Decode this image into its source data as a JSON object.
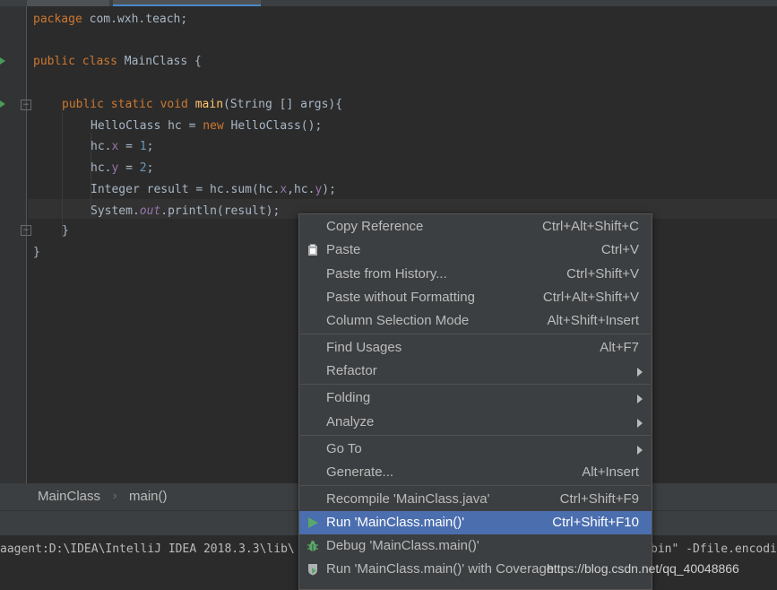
{
  "tabs": [
    "",
    ""
  ],
  "code": {
    "line1": {
      "kw": "package",
      "rest": " com.wxh.teach;"
    },
    "line3": {
      "kw": "public class",
      "rest": " MainClass {"
    },
    "line5": {
      "kw": "public static void",
      "fn": "main",
      "rest": "(String [] args){"
    },
    "line6": {
      "a": "HelloClass hc = ",
      "kw": "new",
      "b": " HelloClass();"
    },
    "line7": {
      "a": "hc.",
      "f": "x",
      "b": " = ",
      "n": "1",
      "c": ";"
    },
    "line8": {
      "a": "hc.",
      "f": "y",
      "b": " = ",
      "n": "2",
      "c": ";"
    },
    "line9": {
      "a": "Integer result = hc.sum(hc.",
      "f1": "x",
      "b": ",hc.",
      "f2": "y",
      "c": ");"
    },
    "line10": {
      "a": "System.",
      "sf": "out",
      "b": ".println(result);"
    },
    "line11": "}",
    "line12": "}"
  },
  "breadcrumb": {
    "class_name": "MainClass",
    "separator": "›",
    "method": "main()"
  },
  "console": {
    "left": "aagent:D:\\IDEA\\IntelliJ IDEA 2018.3.3\\lib\\",
    "right": "bin\" -Dfile.encodi"
  },
  "menu": {
    "items": [
      {
        "label": "Copy Reference",
        "shortcut": "Ctrl+Alt+Shift+C"
      },
      {
        "label": "Paste",
        "shortcut": "Ctrl+V",
        "icon": "clipboard-icon"
      },
      {
        "label": "Paste from History...",
        "shortcut": "Ctrl+Shift+V"
      },
      {
        "label": "Paste without Formatting",
        "shortcut": "Ctrl+Alt+Shift+V"
      },
      {
        "label": "Column Selection Mode",
        "shortcut": "Alt+Shift+Insert"
      },
      {
        "label": "Find Usages",
        "shortcut": "Alt+F7"
      },
      {
        "label": "Refactor",
        "submenu": true
      },
      {
        "label": "Folding",
        "submenu": true
      },
      {
        "label": "Analyze",
        "submenu": true
      },
      {
        "label": "Go To",
        "submenu": true
      },
      {
        "label": "Generate...",
        "shortcut": "Alt+Insert"
      },
      {
        "label": "Recompile 'MainClass.java'",
        "shortcut": "Ctrl+Shift+F9"
      },
      {
        "label": "Run 'MainClass.main()'",
        "shortcut": "Ctrl+Shift+F10",
        "icon": "run-icon",
        "selected": true
      },
      {
        "label": "Debug 'MainClass.main()'",
        "shortcut": "",
        "icon": "debug-icon"
      },
      {
        "label": "Run 'MainClass.main()' with Coverage",
        "shortcut": "",
        "icon": "coverage-icon"
      }
    ]
  },
  "watermark": "https://blog.csdn.net/qq_40048866",
  "colors": {
    "selection": "#4b6eaf",
    "keyword": "#cc7832",
    "method": "#ffc66d",
    "field": "#9876aa",
    "number": "#6897bb"
  }
}
